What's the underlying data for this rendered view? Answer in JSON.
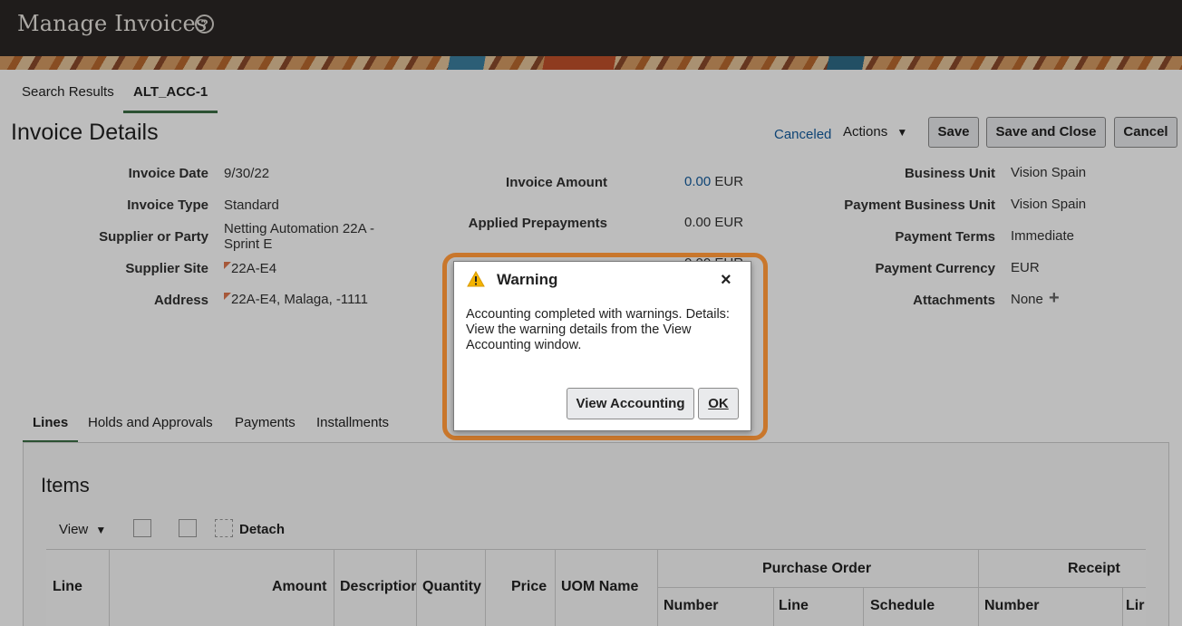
{
  "header": {
    "title": "Manage Invoices",
    "help_icon": "?"
  },
  "tabs": [
    {
      "label": "Search Results"
    },
    {
      "label": "ALT_ACC-1"
    }
  ],
  "page": {
    "title": "Invoice Details",
    "status": "Canceled",
    "actions_label": "Actions",
    "buttons": {
      "save": "Save",
      "save_close": "Save and Close",
      "cancel": "Cancel"
    }
  },
  "left_fields": [
    {
      "label": "Invoice Date",
      "value": "9/30/22"
    },
    {
      "label": "Invoice Type",
      "value": "Standard"
    },
    {
      "label": "Supplier or Party",
      "value": "Netting Automation 22A -",
      "value2": "Sprint E"
    },
    {
      "label": "Supplier Site",
      "value": "22A-E4"
    },
    {
      "label": "Address",
      "value": "22A-E4, Malaga, -1111"
    }
  ],
  "mid_fields": [
    {
      "label": "Invoice Amount",
      "amount": "0.00",
      "currency": "EUR"
    },
    {
      "label": "Applied Prepayments",
      "amount": "0.00",
      "currency": "EUR"
    },
    {
      "label": "",
      "amount": "0.00",
      "currency": "EUR"
    }
  ],
  "right_fields": [
    {
      "label": "Business Unit",
      "value": "Vision Spain"
    },
    {
      "label": "Payment Business Unit",
      "value": "Vision Spain"
    },
    {
      "label": "Payment Terms",
      "value": "Immediate"
    },
    {
      "label": "Payment Currency",
      "value": "EUR"
    },
    {
      "label": "Attachments",
      "value": "None"
    }
  ],
  "subtabs": [
    "Lines",
    "Holds and Approvals",
    "Payments",
    "Installments"
  ],
  "items": {
    "title": "Items",
    "view_label": "View",
    "detach_label": "Detach",
    "columns": [
      "Line",
      "Amount",
      "Descriptior",
      "Quantity",
      "Price",
      "UOM Name"
    ],
    "group_po": {
      "label": "Purchase Order",
      "columns": [
        "Number",
        "Line",
        "Schedule"
      ]
    },
    "group_receipt": {
      "label": "Receipt",
      "columns": [
        "Number",
        "Lir"
      ]
    }
  },
  "dialog": {
    "title": "Warning",
    "close": "×",
    "message": "Accounting completed with warnings. Details: View the warning details from the View Accounting window.",
    "view_button": "View Accounting",
    "ok_button": "OK"
  },
  "colors": {
    "accent": "#145c9e",
    "warning": "#f4b400",
    "highlight": "#c9772c",
    "header_bg": "#2a2725"
  }
}
